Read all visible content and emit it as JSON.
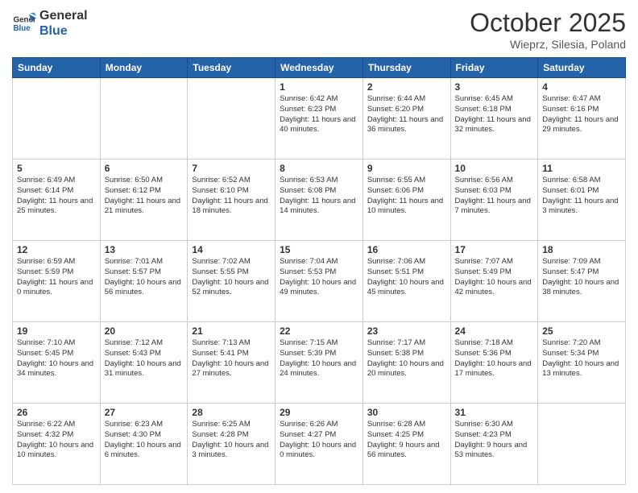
{
  "logo": {
    "line1": "General",
    "line2": "Blue"
  },
  "header": {
    "month": "October 2025",
    "location": "Wieprz, Silesia, Poland"
  },
  "days_of_week": [
    "Sunday",
    "Monday",
    "Tuesday",
    "Wednesday",
    "Thursday",
    "Friday",
    "Saturday"
  ],
  "weeks": [
    [
      {
        "day": "",
        "info": ""
      },
      {
        "day": "",
        "info": ""
      },
      {
        "day": "",
        "info": ""
      },
      {
        "day": "1",
        "info": "Sunrise: 6:42 AM\nSunset: 6:23 PM\nDaylight: 11 hours and 40 minutes."
      },
      {
        "day": "2",
        "info": "Sunrise: 6:44 AM\nSunset: 6:20 PM\nDaylight: 11 hours and 36 minutes."
      },
      {
        "day": "3",
        "info": "Sunrise: 6:45 AM\nSunset: 6:18 PM\nDaylight: 11 hours and 32 minutes."
      },
      {
        "day": "4",
        "info": "Sunrise: 6:47 AM\nSunset: 6:16 PM\nDaylight: 11 hours and 29 minutes."
      }
    ],
    [
      {
        "day": "5",
        "info": "Sunrise: 6:49 AM\nSunset: 6:14 PM\nDaylight: 11 hours and 25 minutes."
      },
      {
        "day": "6",
        "info": "Sunrise: 6:50 AM\nSunset: 6:12 PM\nDaylight: 11 hours and 21 minutes."
      },
      {
        "day": "7",
        "info": "Sunrise: 6:52 AM\nSunset: 6:10 PM\nDaylight: 11 hours and 18 minutes."
      },
      {
        "day": "8",
        "info": "Sunrise: 6:53 AM\nSunset: 6:08 PM\nDaylight: 11 hours and 14 minutes."
      },
      {
        "day": "9",
        "info": "Sunrise: 6:55 AM\nSunset: 6:06 PM\nDaylight: 11 hours and 10 minutes."
      },
      {
        "day": "10",
        "info": "Sunrise: 6:56 AM\nSunset: 6:03 PM\nDaylight: 11 hours and 7 minutes."
      },
      {
        "day": "11",
        "info": "Sunrise: 6:58 AM\nSunset: 6:01 PM\nDaylight: 11 hours and 3 minutes."
      }
    ],
    [
      {
        "day": "12",
        "info": "Sunrise: 6:59 AM\nSunset: 5:59 PM\nDaylight: 11 hours and 0 minutes."
      },
      {
        "day": "13",
        "info": "Sunrise: 7:01 AM\nSunset: 5:57 PM\nDaylight: 10 hours and 56 minutes."
      },
      {
        "day": "14",
        "info": "Sunrise: 7:02 AM\nSunset: 5:55 PM\nDaylight: 10 hours and 52 minutes."
      },
      {
        "day": "15",
        "info": "Sunrise: 7:04 AM\nSunset: 5:53 PM\nDaylight: 10 hours and 49 minutes."
      },
      {
        "day": "16",
        "info": "Sunrise: 7:06 AM\nSunset: 5:51 PM\nDaylight: 10 hours and 45 minutes."
      },
      {
        "day": "17",
        "info": "Sunrise: 7:07 AM\nSunset: 5:49 PM\nDaylight: 10 hours and 42 minutes."
      },
      {
        "day": "18",
        "info": "Sunrise: 7:09 AM\nSunset: 5:47 PM\nDaylight: 10 hours and 38 minutes."
      }
    ],
    [
      {
        "day": "19",
        "info": "Sunrise: 7:10 AM\nSunset: 5:45 PM\nDaylight: 10 hours and 34 minutes."
      },
      {
        "day": "20",
        "info": "Sunrise: 7:12 AM\nSunset: 5:43 PM\nDaylight: 10 hours and 31 minutes."
      },
      {
        "day": "21",
        "info": "Sunrise: 7:13 AM\nSunset: 5:41 PM\nDaylight: 10 hours and 27 minutes."
      },
      {
        "day": "22",
        "info": "Sunrise: 7:15 AM\nSunset: 5:39 PM\nDaylight: 10 hours and 24 minutes."
      },
      {
        "day": "23",
        "info": "Sunrise: 7:17 AM\nSunset: 5:38 PM\nDaylight: 10 hours and 20 minutes."
      },
      {
        "day": "24",
        "info": "Sunrise: 7:18 AM\nSunset: 5:36 PM\nDaylight: 10 hours and 17 minutes."
      },
      {
        "day": "25",
        "info": "Sunrise: 7:20 AM\nSunset: 5:34 PM\nDaylight: 10 hours and 13 minutes."
      }
    ],
    [
      {
        "day": "26",
        "info": "Sunrise: 6:22 AM\nSunset: 4:32 PM\nDaylight: 10 hours and 10 minutes."
      },
      {
        "day": "27",
        "info": "Sunrise: 6:23 AM\nSunset: 4:30 PM\nDaylight: 10 hours and 6 minutes."
      },
      {
        "day": "28",
        "info": "Sunrise: 6:25 AM\nSunset: 4:28 PM\nDaylight: 10 hours and 3 minutes."
      },
      {
        "day": "29",
        "info": "Sunrise: 6:26 AM\nSunset: 4:27 PM\nDaylight: 10 hours and 0 minutes."
      },
      {
        "day": "30",
        "info": "Sunrise: 6:28 AM\nSunset: 4:25 PM\nDaylight: 9 hours and 56 minutes."
      },
      {
        "day": "31",
        "info": "Sunrise: 6:30 AM\nSunset: 4:23 PM\nDaylight: 9 hours and 53 minutes."
      },
      {
        "day": "",
        "info": ""
      }
    ]
  ]
}
